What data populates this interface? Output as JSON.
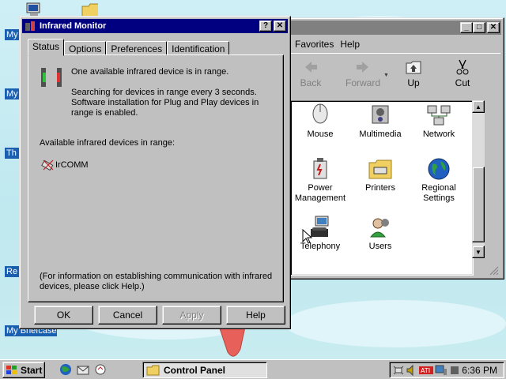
{
  "desktop": {
    "labels": [
      "My",
      "My",
      "Th",
      "Re",
      "My Briefcase"
    ]
  },
  "control_panel": {
    "title": "Control Panel",
    "menu": [
      "Favorites",
      "Help"
    ],
    "toolbar": [
      {
        "label": "Back",
        "icon": "back-arrow-icon",
        "disabled": true
      },
      {
        "label": "Forward",
        "icon": "forward-arrow-icon",
        "disabled": true
      },
      {
        "label": "Up",
        "icon": "up-folder-icon",
        "disabled": false
      },
      {
        "label": "Cut",
        "icon": "scissors-icon",
        "disabled": false
      }
    ],
    "items": [
      {
        "label": "Mouse",
        "icon": "mouse-icon"
      },
      {
        "label": "Multimedia",
        "icon": "multimedia-icon"
      },
      {
        "label": "Network",
        "icon": "network-icon"
      },
      {
        "label": "Power Management",
        "icon": "power-management-icon"
      },
      {
        "label": "Printers",
        "icon": "printers-icon"
      },
      {
        "label": "Regional Settings",
        "icon": "globe-icon"
      },
      {
        "label": "Telephony",
        "icon": "telephony-icon"
      },
      {
        "label": "Users",
        "icon": "users-icon"
      }
    ]
  },
  "dialog": {
    "title": "Infrared Monitor",
    "tabs": [
      "Status",
      "Options",
      "Preferences",
      "Identification"
    ],
    "active_tab": "Status",
    "status_line": "One available infrared device is in range.",
    "search_line1": "Searching for devices in range every 3 seconds.",
    "search_line2": "Software installation for Plug and Play devices in",
    "search_line3": "range is enabled.",
    "available_label": "Available infrared devices in range:",
    "device_name": "IrCOMM",
    "help_line1": "(For information on establishing communication with infrared",
    "help_line2": "devices, please click Help.)",
    "buttons": {
      "ok": "OK",
      "cancel": "Cancel",
      "apply": "Apply",
      "help": "Help"
    }
  },
  "taskbar": {
    "start_label": "Start",
    "task_label": "Control Panel",
    "clock": "6:36 PM"
  },
  "colors": {
    "title_active": "#000080",
    "title_inactive": "#808080",
    "face": "#c0c0c0",
    "desktop": "#c8ecf0"
  }
}
